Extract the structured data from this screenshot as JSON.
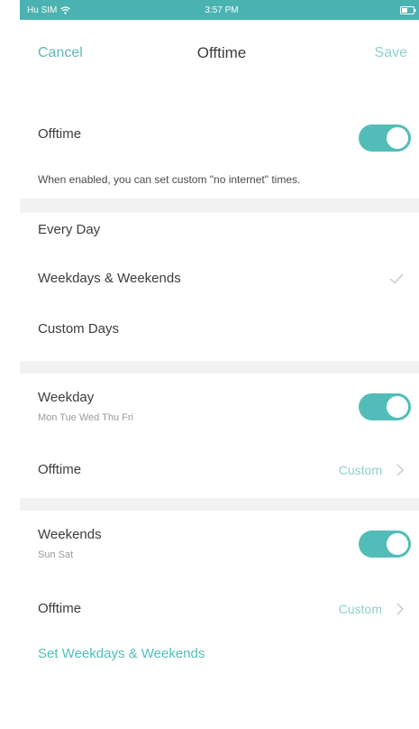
{
  "status_bar": {
    "carrier": "Hu SIM",
    "time": "3:57 PM",
    "battery": "▮▯"
  },
  "nav": {
    "cancel_label": "Cancel",
    "title": "Offtime",
    "save_label": "Save"
  },
  "offtime_section": {
    "label": "Offtime",
    "enabled": true,
    "description": "When enabled, you can set custom \"no internet\" times."
  },
  "schedule_options": [
    {
      "label": "Every Day",
      "selected": false
    },
    {
      "label": "Weekdays & Weekends",
      "selected": true
    },
    {
      "label": "Custom Days",
      "selected": false
    }
  ],
  "weekday_section": {
    "label": "Weekday",
    "days": "Mon Tue Wed Thu Fri",
    "enabled": true,
    "offtime_label": "Offtime",
    "offtime_value": "Custom"
  },
  "weekend_section": {
    "label": "Weekends",
    "days": "Sun Sat",
    "enabled": true,
    "offtime_label": "Offtime",
    "offtime_value": "Custom"
  },
  "set_link": "Set Weekdays & Weekends",
  "colors": {
    "accent": "#52bdb8",
    "status_bar": "#4ab2b0",
    "section_gap": "#f2f2f2"
  }
}
